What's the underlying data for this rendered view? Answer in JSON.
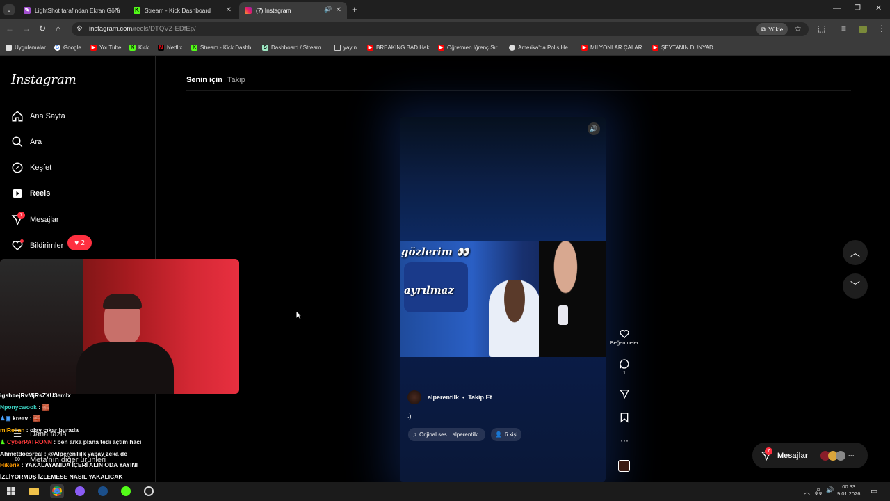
{
  "browser": {
    "tabs": [
      {
        "title": "LightShot tarafından Ekran Görü",
        "icon": "lightshot-icon"
      },
      {
        "title": "Stream - Kick Dashboard",
        "icon": "kick-icon"
      },
      {
        "title": "(7) Instagram",
        "icon": "instagram-icon"
      }
    ],
    "url_domain": "instagram.com",
    "url_path": "/reels/DTQVZ-EDfEp/",
    "install_label": "Yükle",
    "bookmarks": [
      "Uygulamalar",
      "Google",
      "YouTube",
      "Kick",
      "Netflix",
      "Stream - Kick Dashb...",
      "Dashboard / Stream...",
      "yayın",
      "BREAKING BAD Hak...",
      "Öğretmen İğrenç Sır...",
      "Amerika'da Polis He...",
      "MİLYONLAR ÇALAR...",
      "ŞEYTANIN DÜNYAD..."
    ]
  },
  "instagram": {
    "logo": "Instagram",
    "nav": [
      {
        "label": "Ana Sayfa",
        "icon": "home-icon"
      },
      {
        "label": "Ara",
        "icon": "search-icon"
      },
      {
        "label": "Keşfet",
        "icon": "compass-icon"
      },
      {
        "label": "Reels",
        "icon": "reels-icon"
      },
      {
        "label": "Mesajlar",
        "icon": "messenger-icon",
        "badge": "7"
      },
      {
        "label": "Bildirimler",
        "icon": "heart-icon",
        "pill": "2"
      }
    ],
    "more_label": "Daha fazla",
    "meta_label": "Meta'nın diğer ürünleri",
    "feed_tabs": {
      "active": "Senin için",
      "inactive": "Takip"
    },
    "reel": {
      "caption_line1": "gözlerim 👀",
      "caption_line2": "ayrılmaz",
      "username": "alperentilk",
      "dot": "•",
      "follow_label": "Takip Et",
      "description": ":)",
      "audio_label": "Orijinal ses",
      "audio_user": "alperentilk ·",
      "people_label": "6 kişi",
      "likes_label": "Beğenmeler",
      "comments_count": "1"
    },
    "messages_pill": {
      "label": "Mesajlar",
      "badge": "7"
    }
  },
  "chat": [
    {
      "user": "",
      "text": "igsh=ejRvMjRsZXU3emlx",
      "color": "#ffffff"
    },
    {
      "user": "Nponycwook",
      "text": " : 🧱",
      "color": "#3dd6c6"
    },
    {
      "user": "kreav",
      "text": " : 🧱",
      "color": "#ffffff"
    },
    {
      "user": "miRelian",
      "text": " : olay çıkar burada",
      "color": "#ffb000"
    },
    {
      "user": "CyberPATRONN",
      "text": " : ben arka plana tedi açtım hacı",
      "color": "#ff3b3b"
    },
    {
      "user": "Ahmetdoesreal",
      "text": " : @AlperenTilk yapay zeka de",
      "color": "#ffffff"
    },
    {
      "user": "Hikerik",
      "text": " : YAKALAYANIDA İÇERİ ALIN ODA YAYINI",
      "color": "#ff9a00"
    },
    {
      "user": "",
      "text": "İZLİYORMUŞ İZLEMESE NASIL YAKALICAK",
      "color": "#ffffff"
    }
  ],
  "taskbar": {
    "time": "00:33",
    "date": "9.01.2026"
  }
}
